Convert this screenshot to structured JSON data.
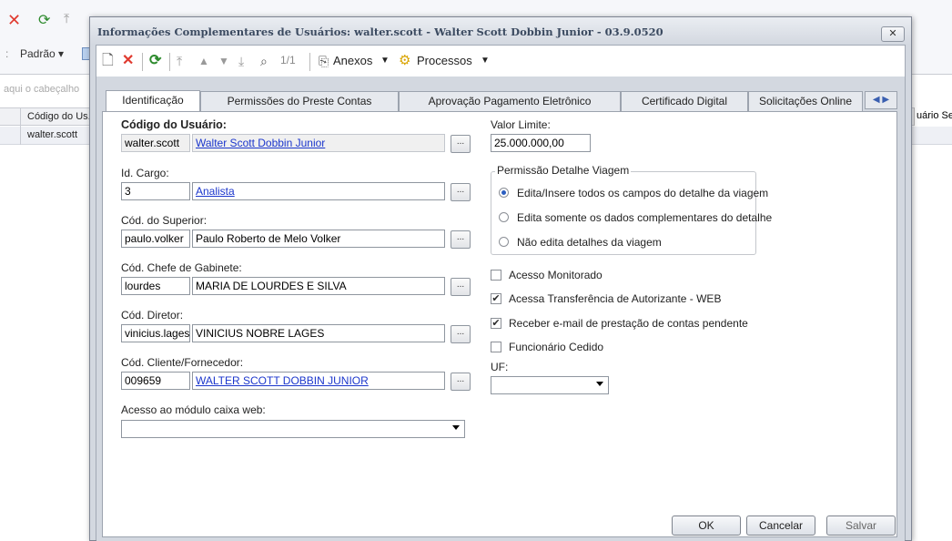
{
  "background": {
    "toolbar_label": "Padrão ▾",
    "filter_hint": "aqui o cabeçalho",
    "col_codigo": "Código do Us.",
    "col_right": "uário Se",
    "row_codigo": "walter.scott"
  },
  "dialog": {
    "title": "Informações Complementares de Usuários: walter.scott - Walter Scott Dobbin Junior - 03.9.0520",
    "close_glyph": "✕"
  },
  "toolbar": {
    "record_counter": "1/1",
    "attachments_label": "Anexos",
    "processes_label": "Processos"
  },
  "tabs": [
    {
      "label": "Identificação"
    },
    {
      "label": "Permissões do Preste Contas"
    },
    {
      "label": "Aprovação Pagamento Eletrônico"
    },
    {
      "label": "Certificado Digital"
    },
    {
      "label": "Solicitações Online"
    }
  ],
  "form": {
    "usuario": {
      "label": "Código do Usuário:",
      "code": "walter.scott",
      "name": "Walter Scott Dobbin Junior"
    },
    "cargo": {
      "label": "Id. Cargo:",
      "code": "3",
      "name": "Analista"
    },
    "superior": {
      "label": "Cód. do Superior:",
      "code": "paulo.volker",
      "name": "Paulo Roberto de Melo Volker"
    },
    "chefe": {
      "label": "Cód. Chefe de Gabinete:",
      "code": "lourdes",
      "name": "MARIA DE LOURDES E SILVA"
    },
    "diretor": {
      "label": "Cód. Diretor:",
      "code": "vinicius.lages",
      "name": "VINICIUS NOBRE LAGES"
    },
    "cliente": {
      "label": "Cód. Cliente/Fornecedor:",
      "code": "009659",
      "name": "WALTER SCOTT DOBBIN JUNIOR"
    },
    "caixa": {
      "label": "Acesso ao módulo caixa web:",
      "value": ""
    },
    "valor_limite": {
      "label": "Valor Limite:",
      "value": "25.000.000,00"
    },
    "viagem": {
      "title": "Permissão Detalhe Viagem",
      "options": [
        {
          "label": "Edita/Insere todos os campos do detalhe da viagem",
          "selected": true
        },
        {
          "label": "Edita somente os dados complementares do detalhe",
          "selected": false
        },
        {
          "label": "Não edita detalhes da viagem",
          "selected": false
        }
      ]
    },
    "checks": [
      {
        "label": "Acesso Monitorado",
        "checked": false
      },
      {
        "label": "Acessa Transferência de Autorizante - WEB",
        "checked": true
      },
      {
        "label": "Receber e-mail de prestação de contas pendente",
        "checked": true
      },
      {
        "label": "Funcionário Cedido",
        "checked": false
      }
    ],
    "uf": {
      "label": "UF:",
      "value": ""
    }
  },
  "buttons": {
    "ok": "OK",
    "cancel": "Cancelar",
    "save": "Salvar",
    "browse": "..."
  },
  "colors": {
    "link": "#1b36cc",
    "delete_icon": "#e03a2f",
    "refresh_icon": "#2e8b2e"
  }
}
